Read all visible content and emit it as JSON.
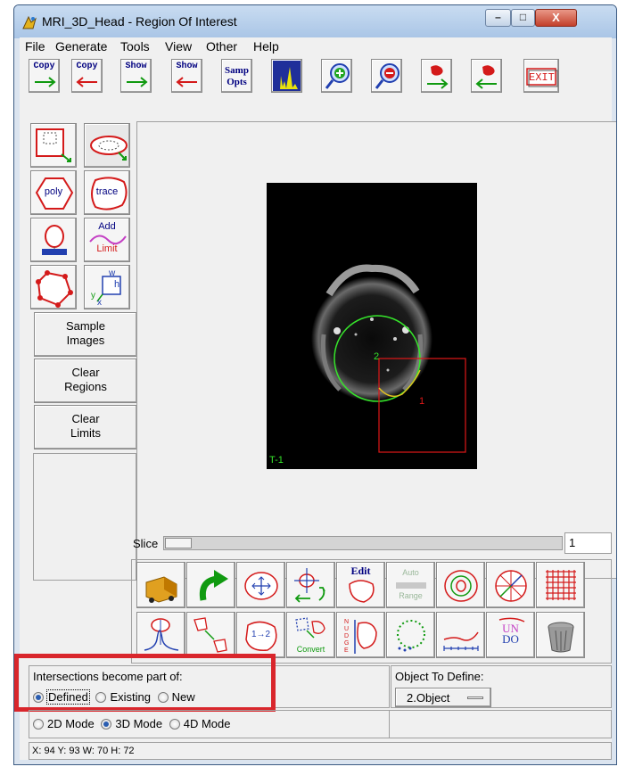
{
  "window": {
    "title": "MRI_3D_Head - Region Of Interest"
  },
  "menu": [
    "File",
    "Generate",
    "Tools",
    "View",
    "Other",
    "Help"
  ],
  "toolbar": {
    "copy_right": "Copy",
    "copy_left": "Copy",
    "show_right": "Show",
    "show_left": "Show",
    "samp_opts_1": "Samp",
    "samp_opts_2": "Opts",
    "exit": "EXIT"
  },
  "left_tools": {
    "poly": "poly",
    "trace": "trace",
    "add_limit_1": "Add",
    "add_limit_2": "Limit",
    "w": "w",
    "h": "h",
    "y": "y",
    "x": "x"
  },
  "buttons": {
    "sample_images": [
      "Sample",
      "Images"
    ],
    "clear_regions": [
      "Clear",
      "Regions"
    ],
    "clear_limits": [
      "Clear",
      "Limits"
    ]
  },
  "image": {
    "label": "T-1",
    "region_green": "2",
    "region_red": "1"
  },
  "slice": {
    "label": "Slice",
    "value": "1"
  },
  "bottom_tools": {
    "edit": "Edit",
    "auto_1": "Auto",
    "auto_2": "Range",
    "undo_1": "UN",
    "undo_2": "DO",
    "convert": "Convert",
    "swap": "1→2"
  },
  "intersections": {
    "label": "Intersections become part of:",
    "options": [
      "Defined",
      "Existing",
      "New"
    ],
    "selected": "Defined"
  },
  "object": {
    "label": "Object To Define:",
    "value": "2.Object"
  },
  "modes": {
    "options": [
      "2D Mode",
      "3D Mode",
      "4D Mode"
    ],
    "selected": "3D Mode"
  },
  "status": "X: 94 Y: 93 W: 70 H: 72",
  "colors": {
    "highlight": "#d9262c",
    "toolbar_text": "#000080",
    "roi_green": "#36e52b",
    "roi_red": "#e01818"
  }
}
